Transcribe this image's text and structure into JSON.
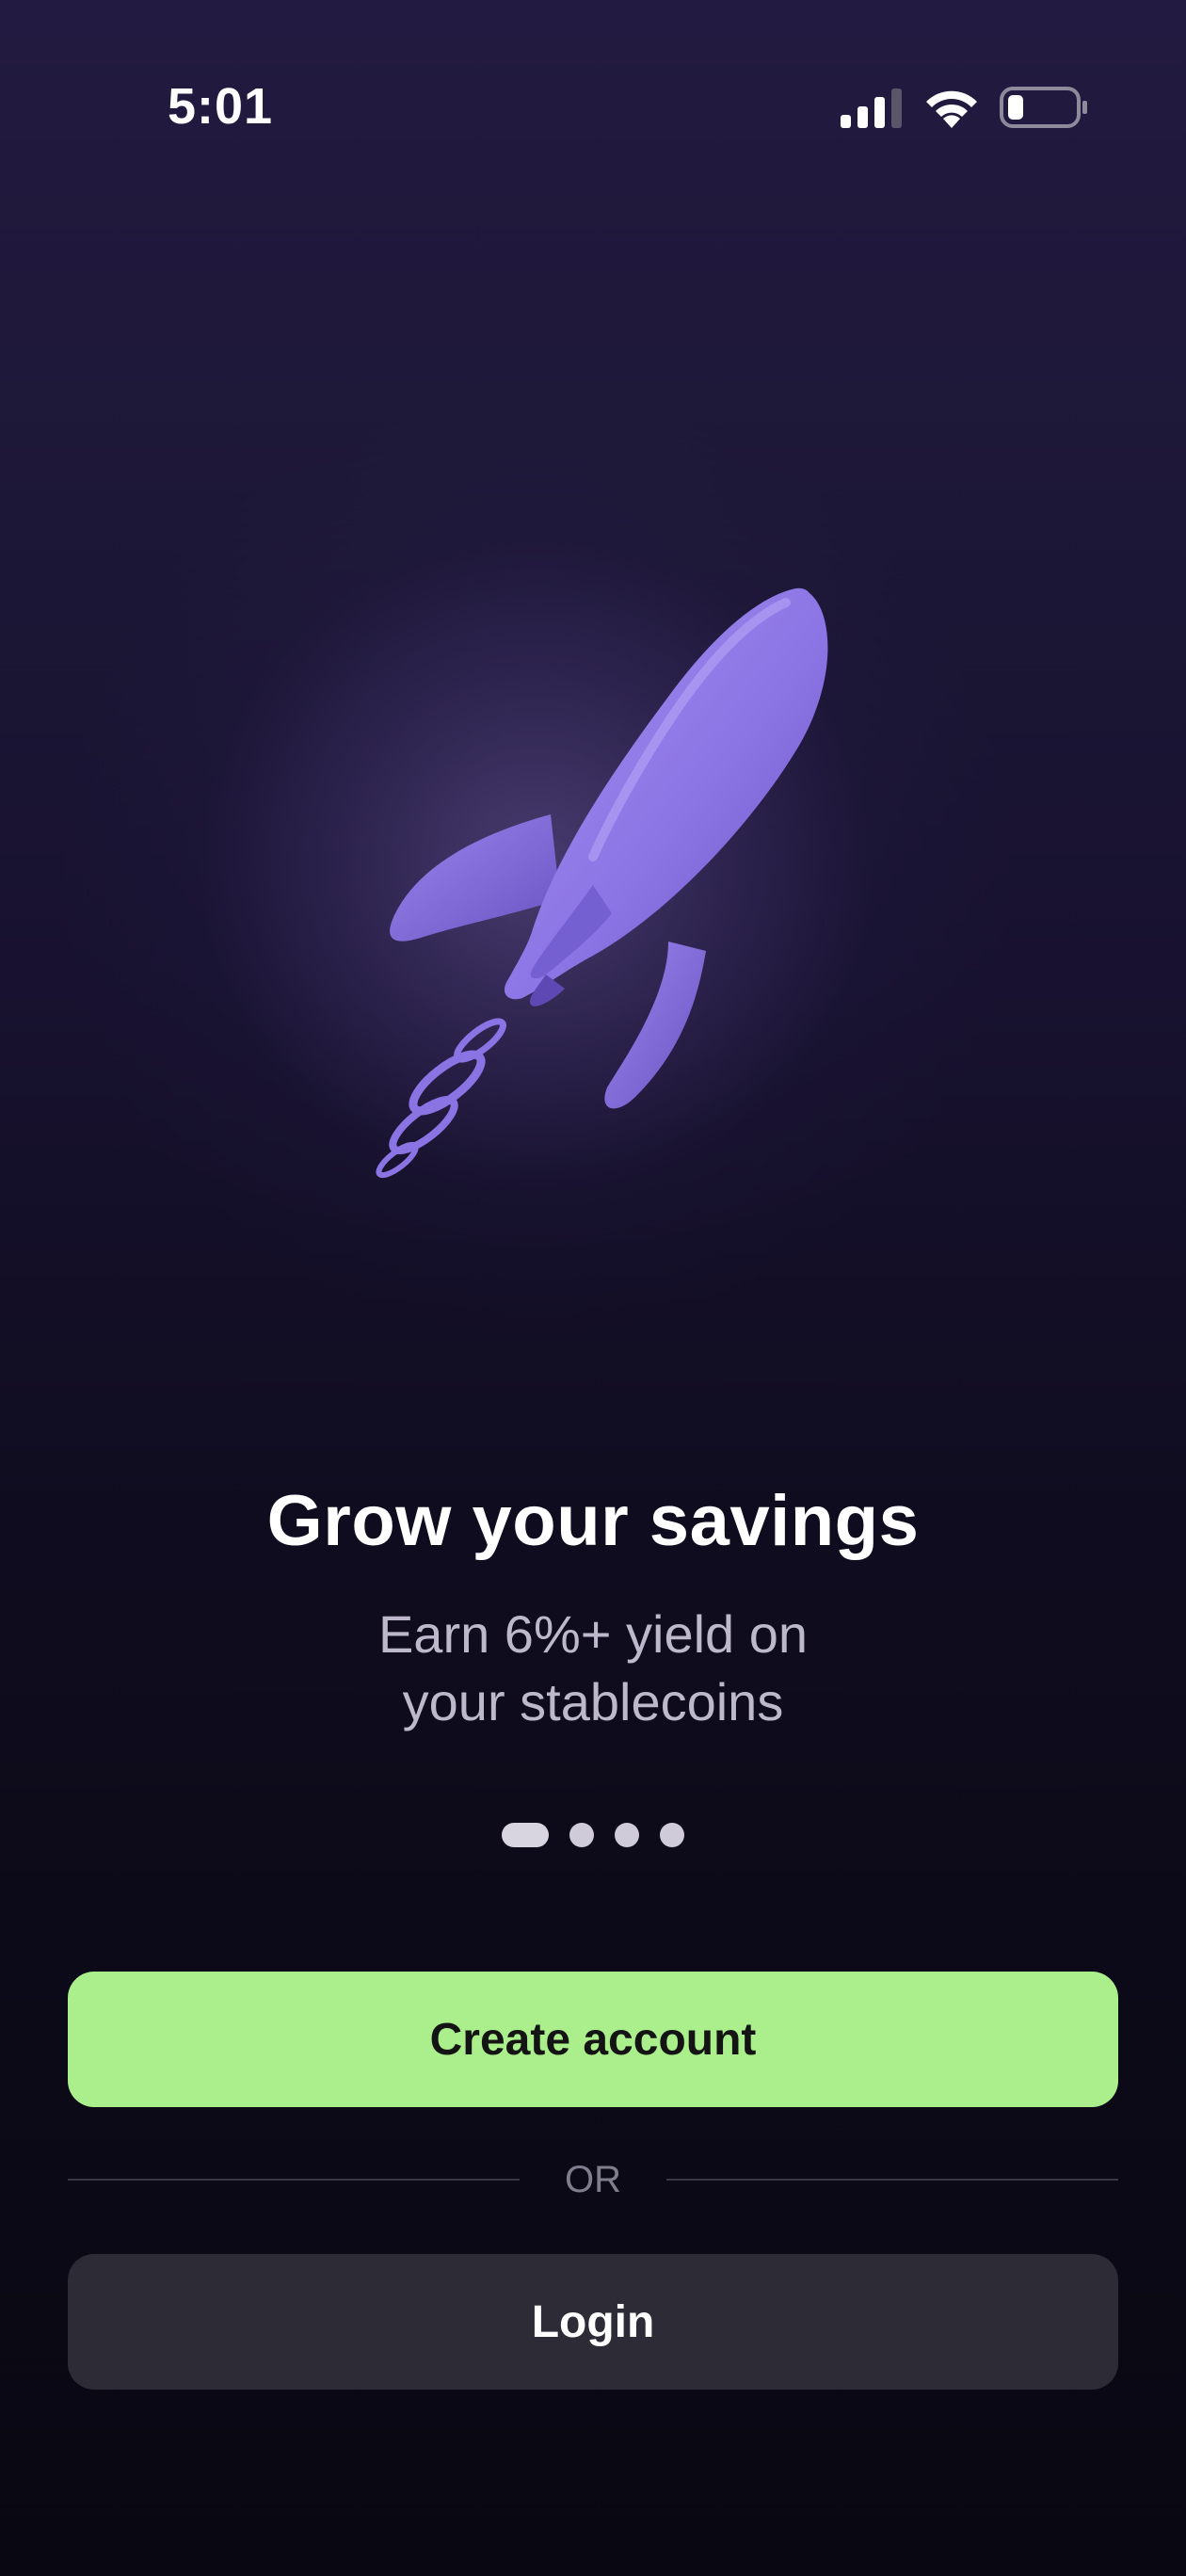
{
  "status_bar": {
    "time": "5:01",
    "icons": [
      "cellular-signal-icon",
      "wifi-icon",
      "battery-icon"
    ]
  },
  "hero": {
    "illustration": "rocket-icon",
    "title": "Grow your savings",
    "subtitle_line1": "Earn 6%+ yield on",
    "subtitle_line2": "your stablecoins"
  },
  "pager": {
    "total": 4,
    "active_index": 0
  },
  "actions": {
    "create_account_label": "Create account",
    "divider_label": "OR",
    "login_label": "Login"
  },
  "colors": {
    "accent": "#abef8c",
    "rocket": "#8f78e6",
    "secondary_button": "#2d2b36"
  }
}
